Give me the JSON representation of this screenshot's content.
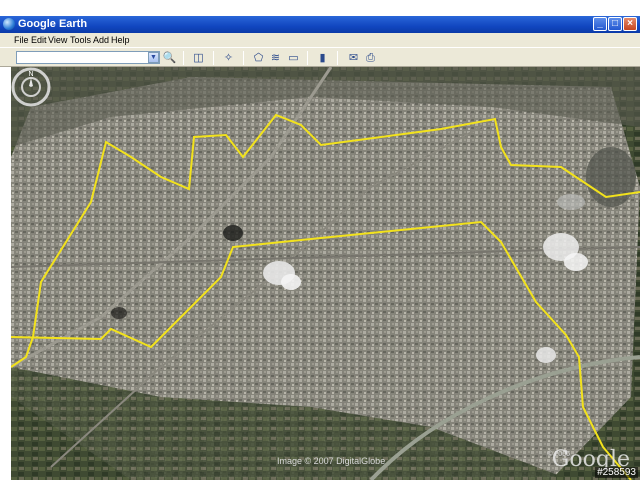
{
  "window": {
    "title": "Google Earth"
  },
  "menu": [
    "File",
    "Edit",
    "View",
    "Tools",
    "Add",
    "Help"
  ],
  "search": {
    "value": ""
  },
  "toolbar": {
    "icons": [
      "search-icon",
      "sidebar-toggle-icon",
      "placemark-icon",
      "polygon-icon",
      "path-icon",
      "image-overlay-icon",
      "ruler-icon",
      "email-icon",
      "print-icon"
    ]
  },
  "map": {
    "attribution": "Image © 2007 DigitalGlobe",
    "year": "© 2006",
    "brand": "Google",
    "image_id": "#258593",
    "compass_label": "N",
    "boundary_color": "#f2e21c"
  }
}
